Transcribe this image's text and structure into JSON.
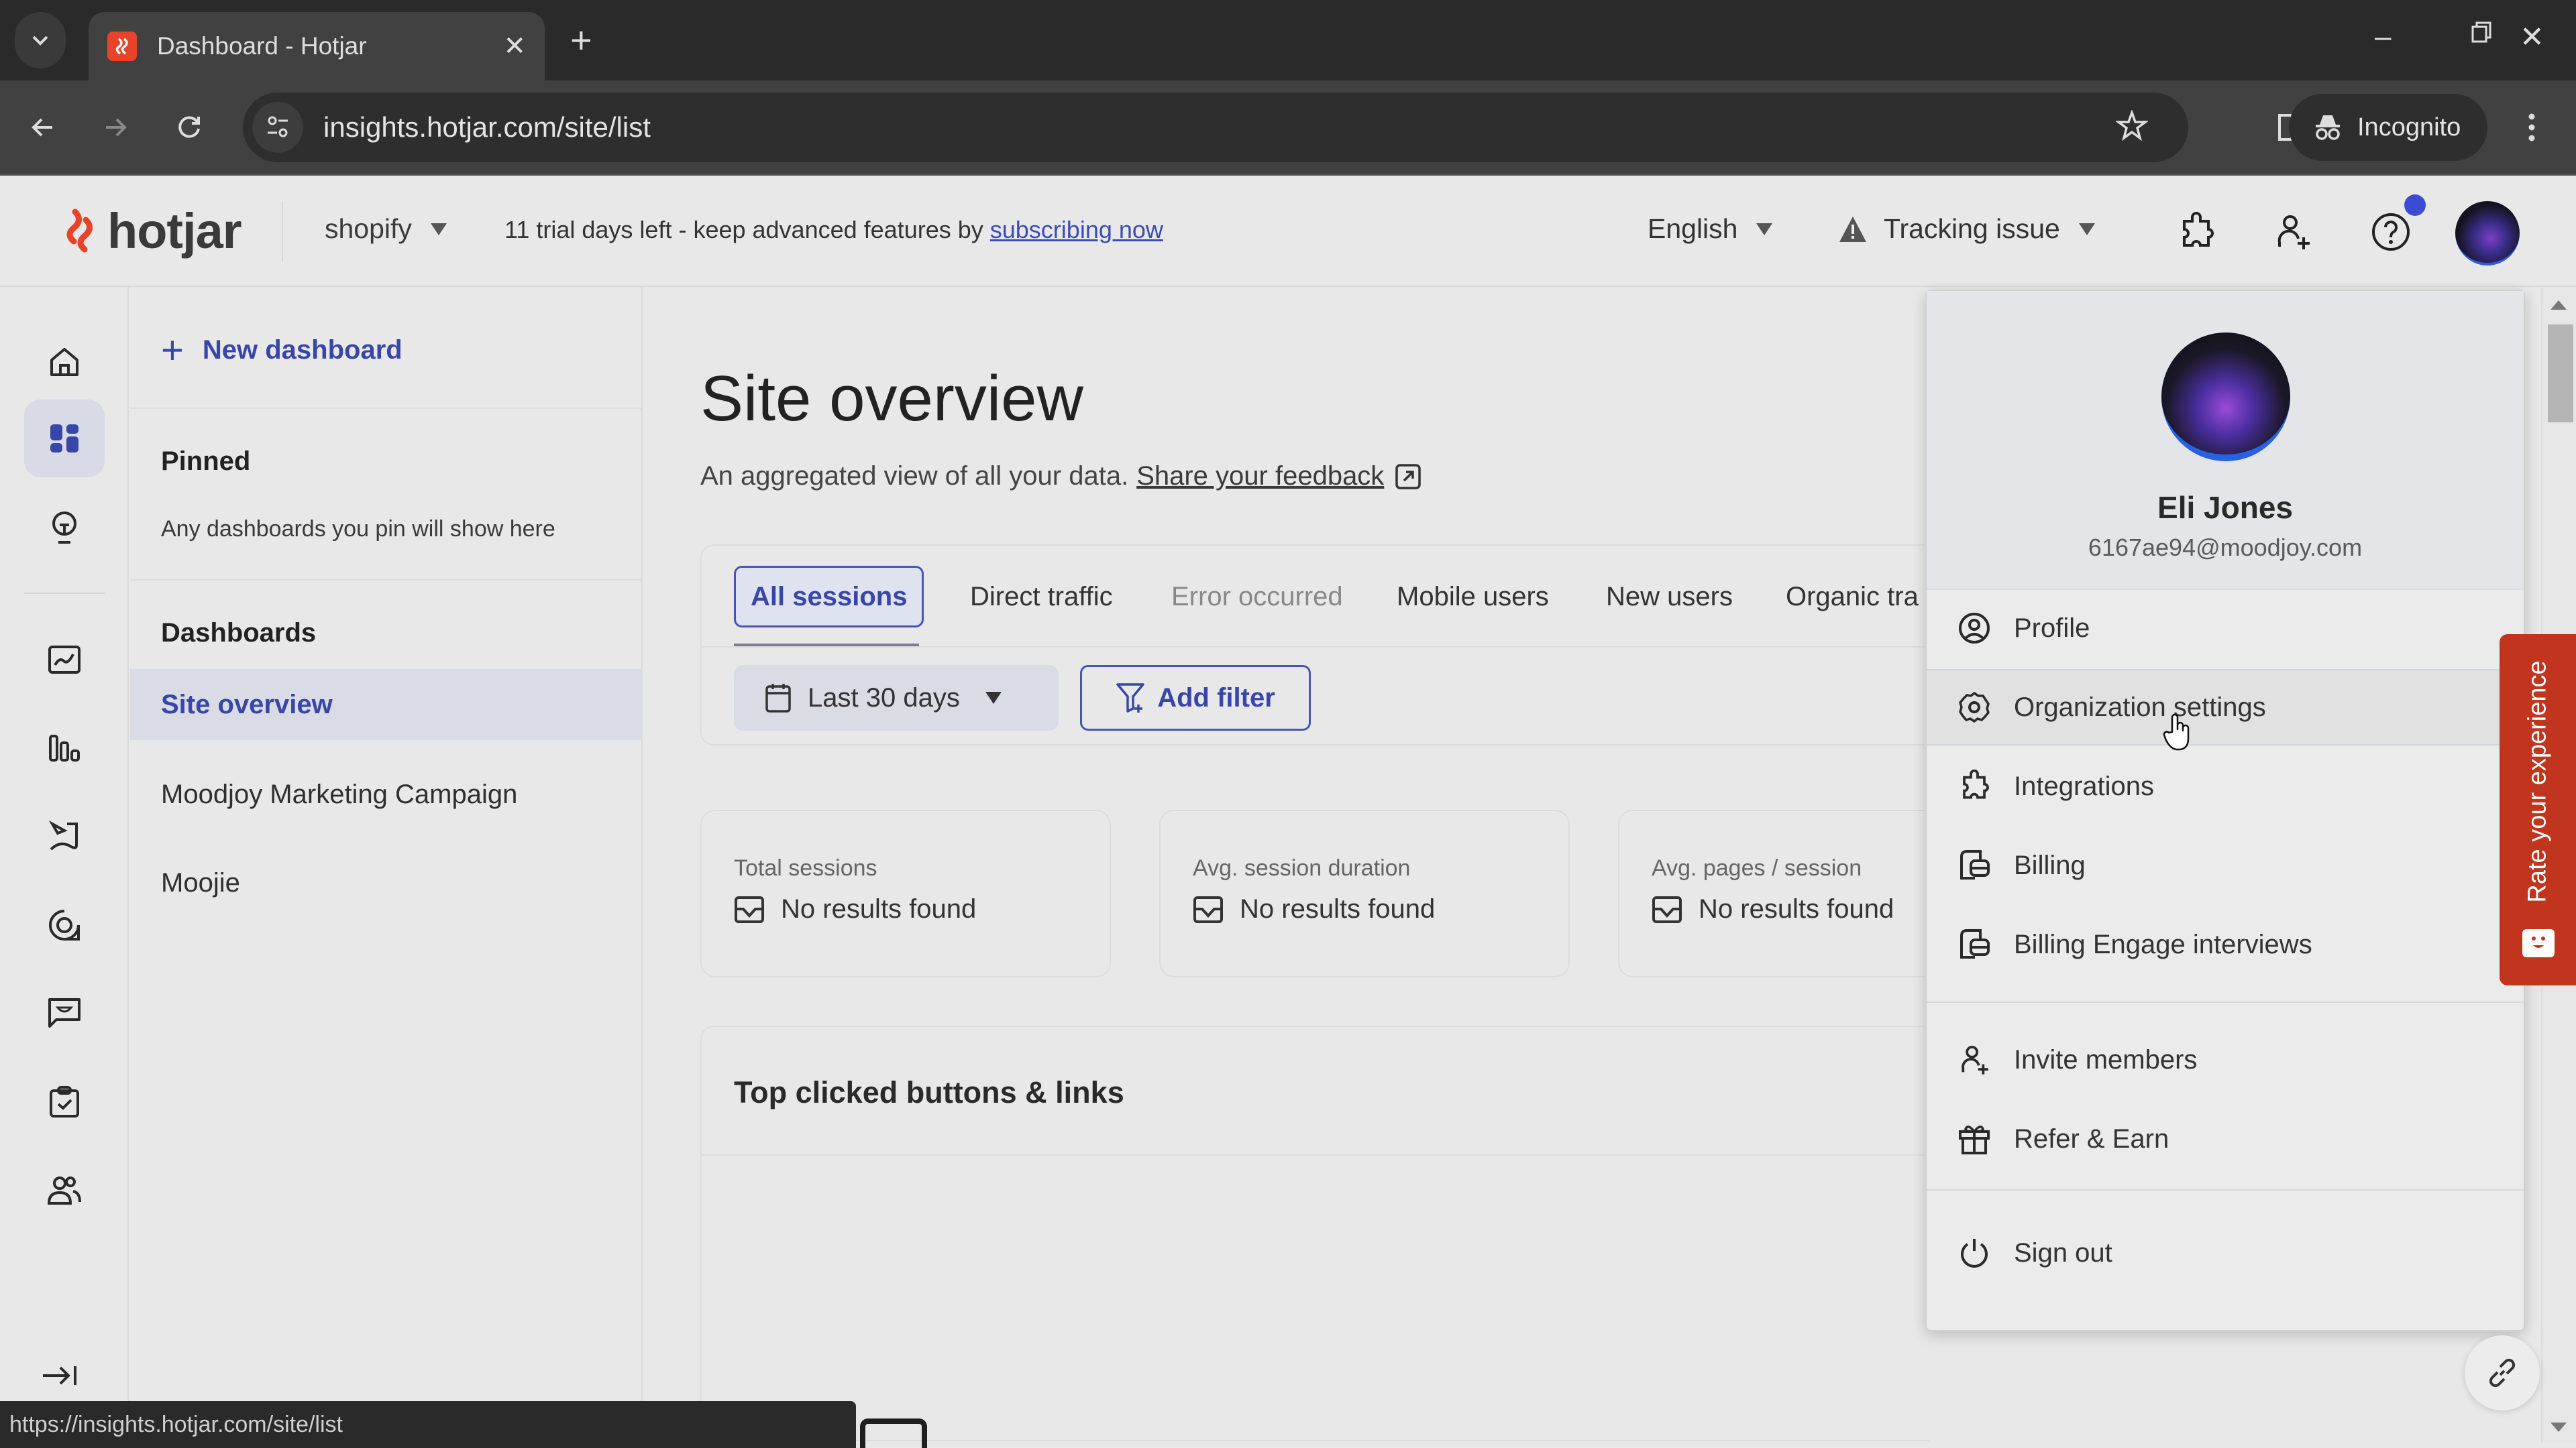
{
  "browser": {
    "tab_title": "Dashboard - Hotjar",
    "url": "insights.hotjar.com/site/list",
    "profile_label": "Incognito",
    "status_url": "https://insights.hotjar.com/site/list"
  },
  "header": {
    "logo_text": "hotjar",
    "site_name": "shopify",
    "trial_text": "11 trial days left - keep advanced features by",
    "trial_link": "subscribing now",
    "language": "English",
    "tracking_label": "Tracking issue",
    "has_notification": true
  },
  "rail": {
    "items": [
      {
        "name": "home",
        "active": false
      },
      {
        "name": "dashboards",
        "active": true
      },
      {
        "name": "highlights",
        "active": false
      },
      {
        "name": "trends",
        "active": false
      },
      {
        "name": "funnels",
        "active": false
      },
      {
        "name": "recordings",
        "active": false
      },
      {
        "name": "heatmaps",
        "active": false
      },
      {
        "name": "feedback",
        "active": false
      },
      {
        "name": "surveys",
        "active": false
      },
      {
        "name": "interviews",
        "active": false
      }
    ]
  },
  "panel": {
    "new_dashboard_label": "New dashboard",
    "pinned_heading": "Pinned",
    "pinned_empty": "Any dashboards you pin will show here",
    "dashboards_heading": "Dashboards",
    "dashboards": [
      {
        "label": "Site overview",
        "active": true
      },
      {
        "label": "Moodjoy Marketing Campaign",
        "active": false
      },
      {
        "label": "Moojie",
        "active": false
      }
    ]
  },
  "main": {
    "title": "Site overview",
    "subtitle": "An aggregated view of all your data.",
    "feedback_link": "Share your feedback",
    "segments": [
      {
        "label": "All sessions",
        "active": true
      },
      {
        "label": "Direct traffic",
        "active": false
      },
      {
        "label": "Error occurred",
        "active": false,
        "muted": true
      },
      {
        "label": "Mobile users",
        "active": false
      },
      {
        "label": "New users",
        "active": false
      },
      {
        "label": "Organic tra",
        "active": false
      }
    ],
    "date_range": "Last 30 days",
    "add_filter_label": "Add filter",
    "metrics": [
      {
        "label": "Total sessions",
        "value": "No results found"
      },
      {
        "label": "Avg. session duration",
        "value": "No results found"
      },
      {
        "label": "Avg. pages / session",
        "value": "No results found"
      }
    ],
    "top_clicked_title": "Top clicked buttons & links"
  },
  "menu": {
    "user_name": "Eli Jones",
    "user_email": "6167ae94@moodjoy.com",
    "items": [
      {
        "label": "Profile",
        "icon": "user-circle-icon"
      },
      {
        "label": "Organization settings",
        "icon": "gear-icon",
        "hovered": true
      },
      {
        "label": "Integrations",
        "icon": "puzzle-icon"
      },
      {
        "label": "Billing",
        "icon": "billing-icon"
      },
      {
        "label": "Billing Engage interviews",
        "icon": "billing-icon"
      },
      {
        "label": "Invite members",
        "icon": "user-plus-icon"
      },
      {
        "label": "Refer & Earn",
        "icon": "gift-icon"
      },
      {
        "label": "Sign out",
        "icon": "power-icon"
      }
    ]
  },
  "feedback_tab": {
    "label": "Rate your experience",
    "color": "#c1341e"
  },
  "colors": {
    "accent": "#3846a8",
    "brand": "#e8432a",
    "notification": "#3b4bd4"
  }
}
